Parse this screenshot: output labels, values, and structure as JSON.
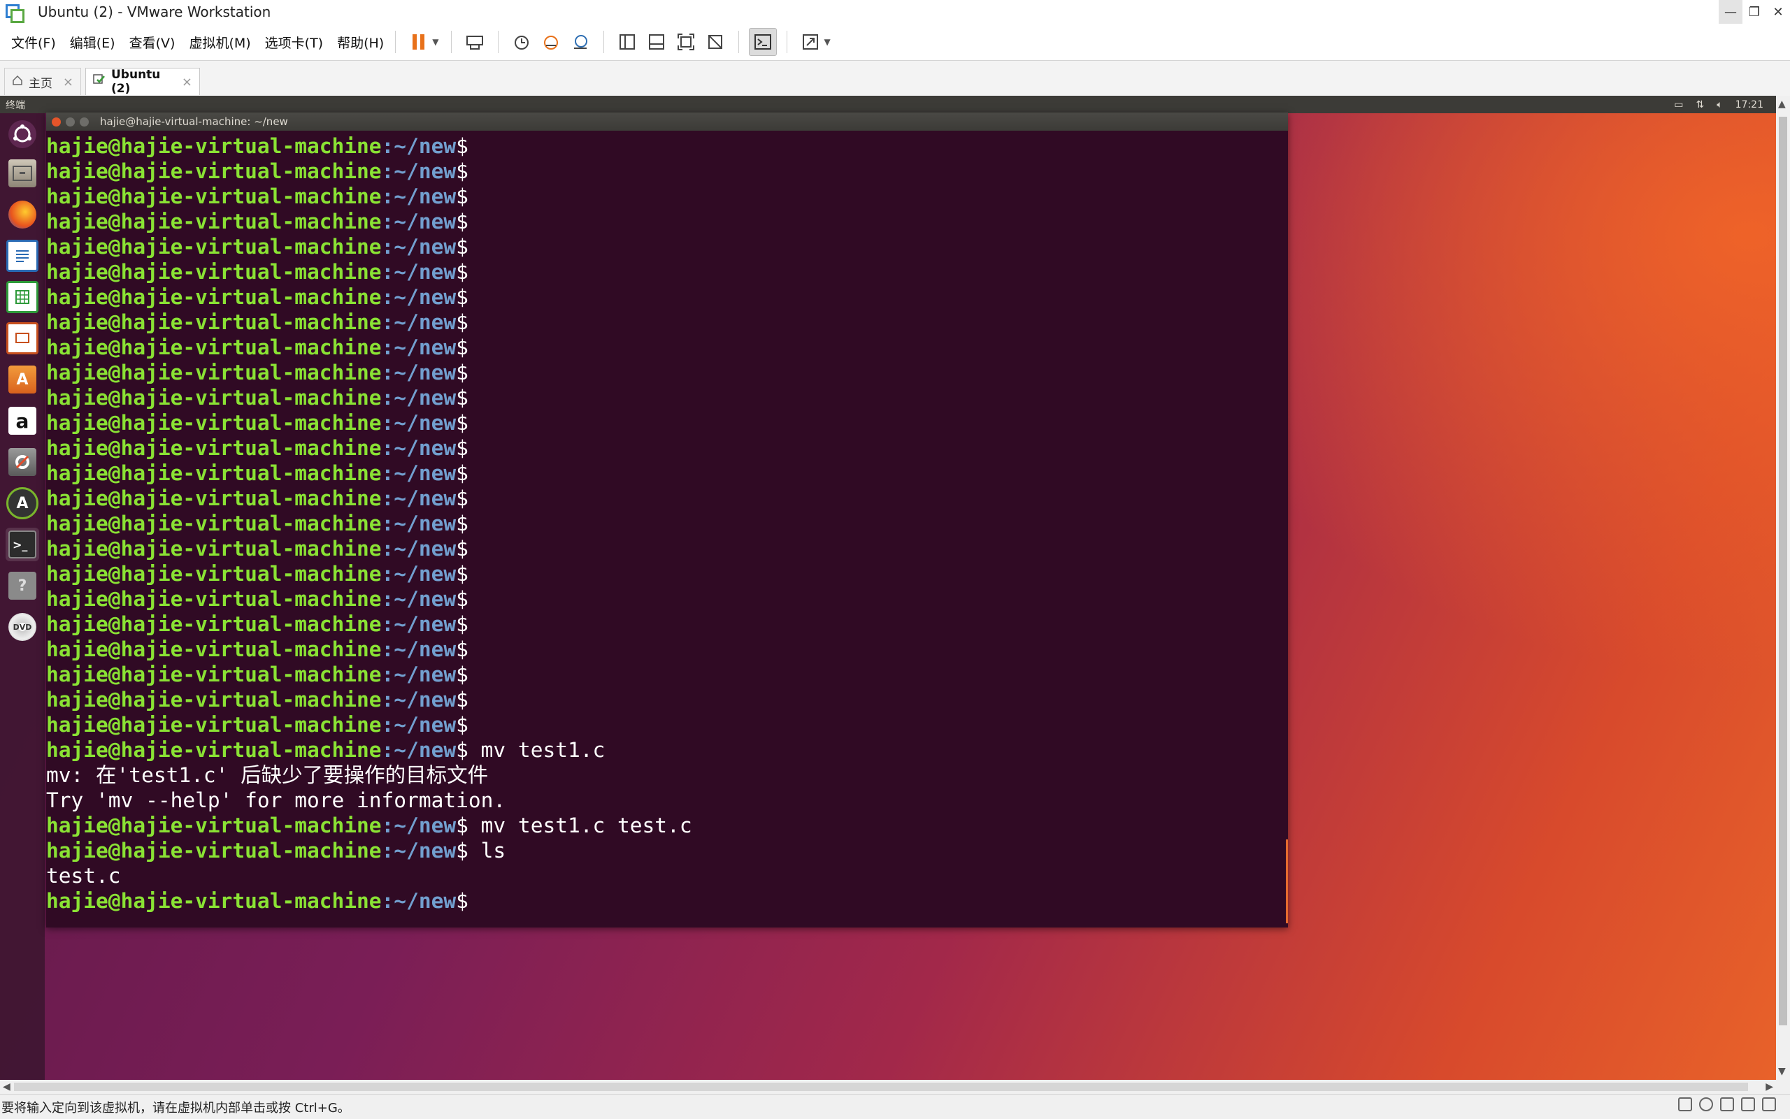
{
  "window": {
    "title": "Ubuntu (2) - VMware Workstation",
    "minimize": "—",
    "restore": "❐",
    "close": "✕"
  },
  "menu": [
    "文件(F)",
    "编辑(E)",
    "查看(V)",
    "虚拟机(M)",
    "选项卡(T)",
    "帮助(H)"
  ],
  "tabs": {
    "home": "主页",
    "vm": "Ubuntu (2)"
  },
  "ubuntu": {
    "topbar_app": "终端",
    "clock": "17:21"
  },
  "terminal": {
    "title": "hajie@hajie-virtual-machine: ~/new",
    "user_host": "hajie@hajie-virtual-machine",
    "path": ":~/new",
    "dollar": "$",
    "lines": [
      {
        "type": "prompt",
        "cmd": ""
      },
      {
        "type": "prompt",
        "cmd": ""
      },
      {
        "type": "prompt",
        "cmd": ""
      },
      {
        "type": "prompt",
        "cmd": ""
      },
      {
        "type": "prompt",
        "cmd": ""
      },
      {
        "type": "prompt",
        "cmd": ""
      },
      {
        "type": "prompt",
        "cmd": ""
      },
      {
        "type": "prompt",
        "cmd": ""
      },
      {
        "type": "prompt",
        "cmd": ""
      },
      {
        "type": "prompt",
        "cmd": ""
      },
      {
        "type": "prompt",
        "cmd": ""
      },
      {
        "type": "prompt",
        "cmd": ""
      },
      {
        "type": "prompt",
        "cmd": ""
      },
      {
        "type": "prompt",
        "cmd": ""
      },
      {
        "type": "prompt",
        "cmd": ""
      },
      {
        "type": "prompt",
        "cmd": ""
      },
      {
        "type": "prompt",
        "cmd": ""
      },
      {
        "type": "prompt",
        "cmd": ""
      },
      {
        "type": "prompt",
        "cmd": ""
      },
      {
        "type": "prompt",
        "cmd": ""
      },
      {
        "type": "prompt",
        "cmd": ""
      },
      {
        "type": "prompt",
        "cmd": ""
      },
      {
        "type": "prompt",
        "cmd": ""
      },
      {
        "type": "prompt",
        "cmd": ""
      },
      {
        "type": "prompt",
        "cmd": " mv test1.c"
      },
      {
        "type": "output",
        "text": "mv: 在'test1.c' 后缺少了要操作的目标文件"
      },
      {
        "type": "output",
        "text": "Try 'mv --help' for more information."
      },
      {
        "type": "prompt",
        "cmd": " mv test1.c test.c"
      },
      {
        "type": "prompt",
        "cmd": " ls"
      },
      {
        "type": "output",
        "text": "test.c"
      },
      {
        "type": "prompt",
        "cmd": ""
      }
    ]
  },
  "status": {
    "message": "要将输入定向到该虚拟机，请在虚拟机内部单击或按 Ctrl+G。"
  },
  "colors": {
    "prompt_user": "#8ae234",
    "prompt_path": "#729fcf",
    "terminal_bg": "#300a24",
    "pause_orange": "#e8711a"
  }
}
